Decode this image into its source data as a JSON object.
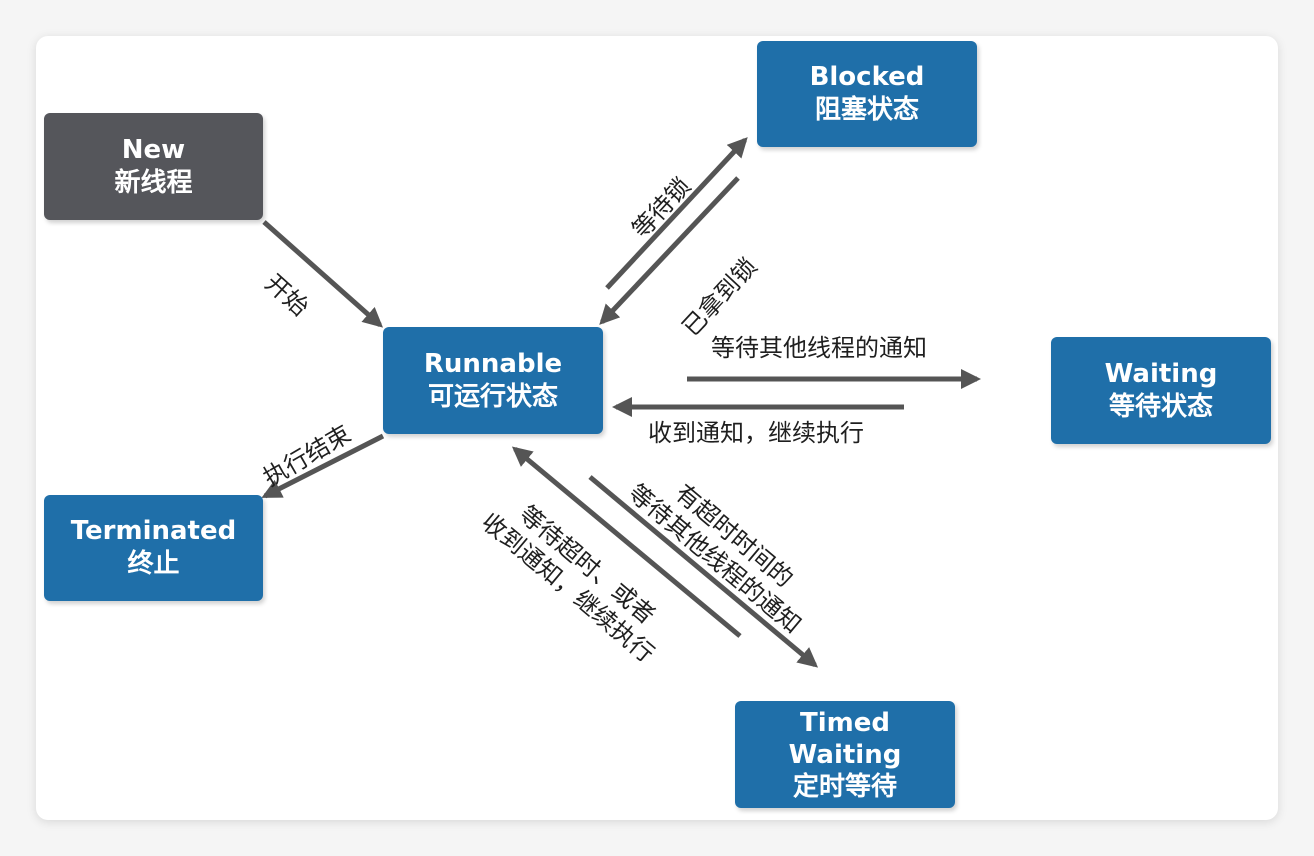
{
  "colors": {
    "state_blue": "#1f6fa9",
    "state_gray": "#55565b",
    "arrow": "#555555",
    "label": "#1f1f1f"
  },
  "states": {
    "new": {
      "en": "New",
      "zh": "新线程"
    },
    "runnable": {
      "en": "Runnable",
      "zh": "可运行状态"
    },
    "blocked": {
      "en": "Blocked",
      "zh": "阻塞状态"
    },
    "waiting": {
      "en": "Waiting",
      "zh": "等待状态"
    },
    "timed_waiting": {
      "en_line1": "Timed",
      "en_line2": "Waiting",
      "zh": "定时等待"
    },
    "terminated": {
      "en": "Terminated",
      "zh": "终止"
    }
  },
  "transitions": {
    "start": "开始",
    "wait_lock": "等待锁",
    "got_lock": "已拿到锁",
    "wait_notify": "等待其他线程的通知",
    "receive_notify": "收到通知，继续执行",
    "finish": "执行结束",
    "timed_wait": {
      "line1": "有超时时间的",
      "line2": "等待其他线程的通知"
    },
    "timeout_or_notify": {
      "line1": "等待超时、或者",
      "line2": "收到通知，继续执行"
    }
  }
}
